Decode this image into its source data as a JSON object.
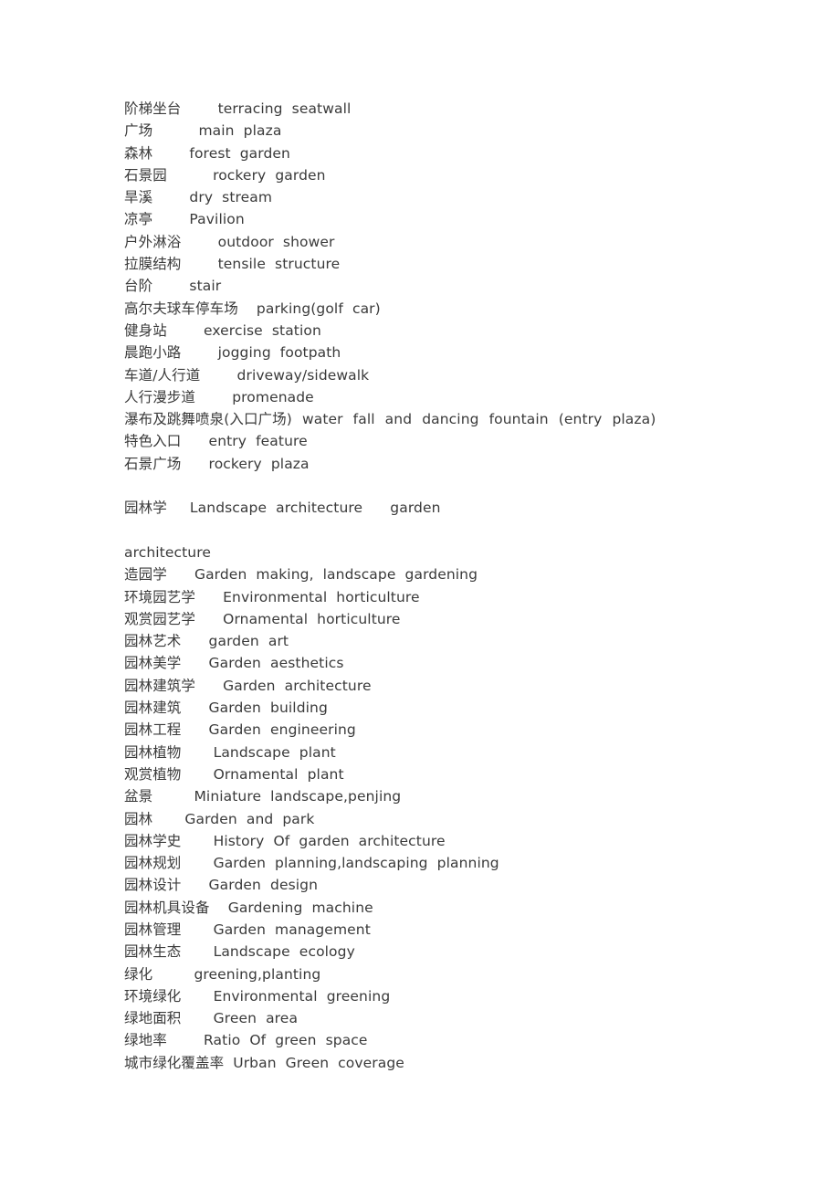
{
  "document": {
    "type": "bilingual-glossary",
    "language_pair": "Chinese-English",
    "text_color": "#3a3a3a",
    "background_color": "#ffffff",
    "blocks": [
      {
        "kind": "line",
        "text": "阶梯坐台        terracing  seatwall"
      },
      {
        "kind": "line",
        "text": "广场          main  plaza"
      },
      {
        "kind": "line",
        "text": "森林        forest  garden"
      },
      {
        "kind": "line",
        "text": "石景园          rockery  garden"
      },
      {
        "kind": "line",
        "text": "旱溪        dry  stream"
      },
      {
        "kind": "line",
        "text": "凉亭        Pavilion"
      },
      {
        "kind": "line",
        "text": "户外淋浴        outdoor  shower"
      },
      {
        "kind": "line",
        "text": "拉膜结构        tensile  structure"
      },
      {
        "kind": "line",
        "text": "台阶        stair"
      },
      {
        "kind": "line",
        "text": "高尔夫球车停车场    parking(golf  car)"
      },
      {
        "kind": "line",
        "text": "健身站        exercise  station"
      },
      {
        "kind": "line",
        "text": "晨跑小路        jogging  footpath"
      },
      {
        "kind": "line",
        "text": "车道/人行道        driveway/sidewalk"
      },
      {
        "kind": "line",
        "text": "人行漫步道        promenade"
      },
      {
        "kind": "justified",
        "text": "瀑布及跳舞喷泉(入口广场)  water  fall  and  dancing  fountain  (entry  plaza)"
      },
      {
        "kind": "line",
        "text": "特色入口      entry  feature"
      },
      {
        "kind": "line",
        "text": "石景广场      rockery  plaza"
      },
      {
        "kind": "blank",
        "text": ""
      },
      {
        "kind": "line",
        "text": "园林学     Landscape  architecture      garden"
      },
      {
        "kind": "blank",
        "text": ""
      },
      {
        "kind": "line",
        "text": "architecture"
      },
      {
        "kind": "line",
        "text": "造园学      Garden  making,  landscape  gardening"
      },
      {
        "kind": "line",
        "text": "环境园艺学      Environmental  horticulture"
      },
      {
        "kind": "line",
        "text": "观赏园艺学      Ornamental  horticulture"
      },
      {
        "kind": "line",
        "text": "园林艺术      garden  art"
      },
      {
        "kind": "line",
        "text": "园林美学      Garden  aesthetics"
      },
      {
        "kind": "line",
        "text": "园林建筑学      Garden  architecture"
      },
      {
        "kind": "line",
        "text": "园林建筑      Garden  building"
      },
      {
        "kind": "line",
        "text": "园林工程      Garden  engineering"
      },
      {
        "kind": "line",
        "text": "园林植物       Landscape  plant"
      },
      {
        "kind": "line",
        "text": "观赏植物       Ornamental  plant"
      },
      {
        "kind": "line",
        "text": "盆景         Miniature  landscape,penjing"
      },
      {
        "kind": "line",
        "text": "园林       Garden  and  park"
      },
      {
        "kind": "line",
        "text": "园林学史       History  Of  garden  architecture"
      },
      {
        "kind": "line",
        "text": "园林规划       Garden  planning,landscaping  planning"
      },
      {
        "kind": "line",
        "text": "园林设计      Garden  design"
      },
      {
        "kind": "line",
        "text": "园林机具设备    Gardening  machine"
      },
      {
        "kind": "line",
        "text": "园林管理       Garden  management"
      },
      {
        "kind": "line",
        "text": "园林生态       Landscape  ecology"
      },
      {
        "kind": "line",
        "text": "绿化         greening,planting"
      },
      {
        "kind": "line",
        "text": "环境绿化       Environmental  greening"
      },
      {
        "kind": "line",
        "text": "绿地面积       Green  area"
      },
      {
        "kind": "line",
        "text": "绿地率        Ratio  Of  green  space"
      },
      {
        "kind": "line",
        "text": "城市绿化覆盖率  Urban  Green  coverage"
      }
    ]
  }
}
